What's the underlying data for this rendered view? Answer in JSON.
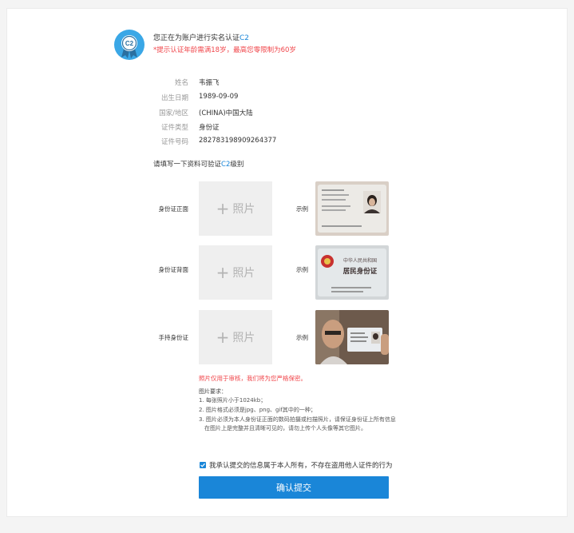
{
  "header": {
    "title_prefix": "您正在为账户进行实名认证",
    "level": "C2",
    "note": "*提示认证年龄需满18岁，最高您零限制为60岁"
  },
  "info": [
    {
      "label": "姓名",
      "value": "韦振飞"
    },
    {
      "label": "出生日期",
      "value": "1989-09-09"
    },
    {
      "label": "国家/地区",
      "value": "(CHINA)中国大陆"
    },
    {
      "label": "证件类型",
      "value": "身份证"
    },
    {
      "label": "证件号码",
      "value": "282783198909264377"
    }
  ],
  "section": {
    "title_prefix": "请填写一下资料可验证",
    "level": "C2",
    "title_suffix": "级别"
  },
  "uploads": [
    {
      "label": "身份证正面",
      "upload_text": "照片",
      "example_label": "示例"
    },
    {
      "label": "身份证背面",
      "upload_text": "照片",
      "example_label": "示例"
    },
    {
      "label": "手持身份证",
      "upload_text": "照片",
      "example_label": "示例"
    }
  ],
  "examples": {
    "back_card_line1": "中华人民共和国",
    "back_card_line2": "居民身份证"
  },
  "privacy_note": "照片仅用于审核，我们将为您严格保密。",
  "requirements": {
    "title": "图片要求：",
    "items": [
      "1. 每张照片小于1024kb；",
      "2. 图片格式必须是jpg、png、gif其中的一种；",
      "3. 图片必须为本人身份证正面的数码拍摄或扫描照片，请保证身份证上所有信息",
      "在图片上是完整并且清晰可见的，请勿上传个人头像等其它图片。"
    ]
  },
  "agreement": {
    "checked": true,
    "text": "我承认提交的信息属于本人所有，不存在盗用他人证件的行为"
  },
  "submit_label": "确认提交",
  "colors": {
    "accent": "#1a86d8",
    "warning": "#f0454a",
    "upload_bg": "#efefef"
  }
}
